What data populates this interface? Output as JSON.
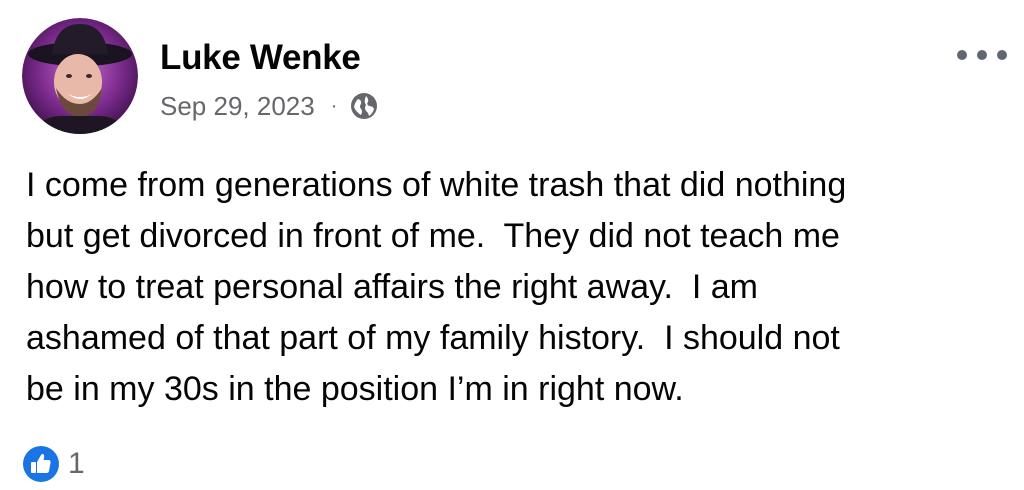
{
  "post": {
    "author_name": "Luke Wenke",
    "date": "Sep 29, 2023",
    "separator": "·",
    "privacy_icon": "globe-icon",
    "more_icon": "more-horizontal-icon",
    "body": "I come from generations of white trash that did nothing\nbut get divorced in front of me.  They did not teach me\nhow to treat personal affairs the right away.  I am\nashamed of that part of my family history.  I should not\nbe in my 30s in the position I’m in right now.",
    "reaction_icon": "like-icon",
    "reaction_count": "1"
  },
  "colors": {
    "text": "#050505",
    "secondary_text": "#65676b",
    "like_blue": "#1b74e4",
    "avatar_ring": "#9b3fa6"
  }
}
